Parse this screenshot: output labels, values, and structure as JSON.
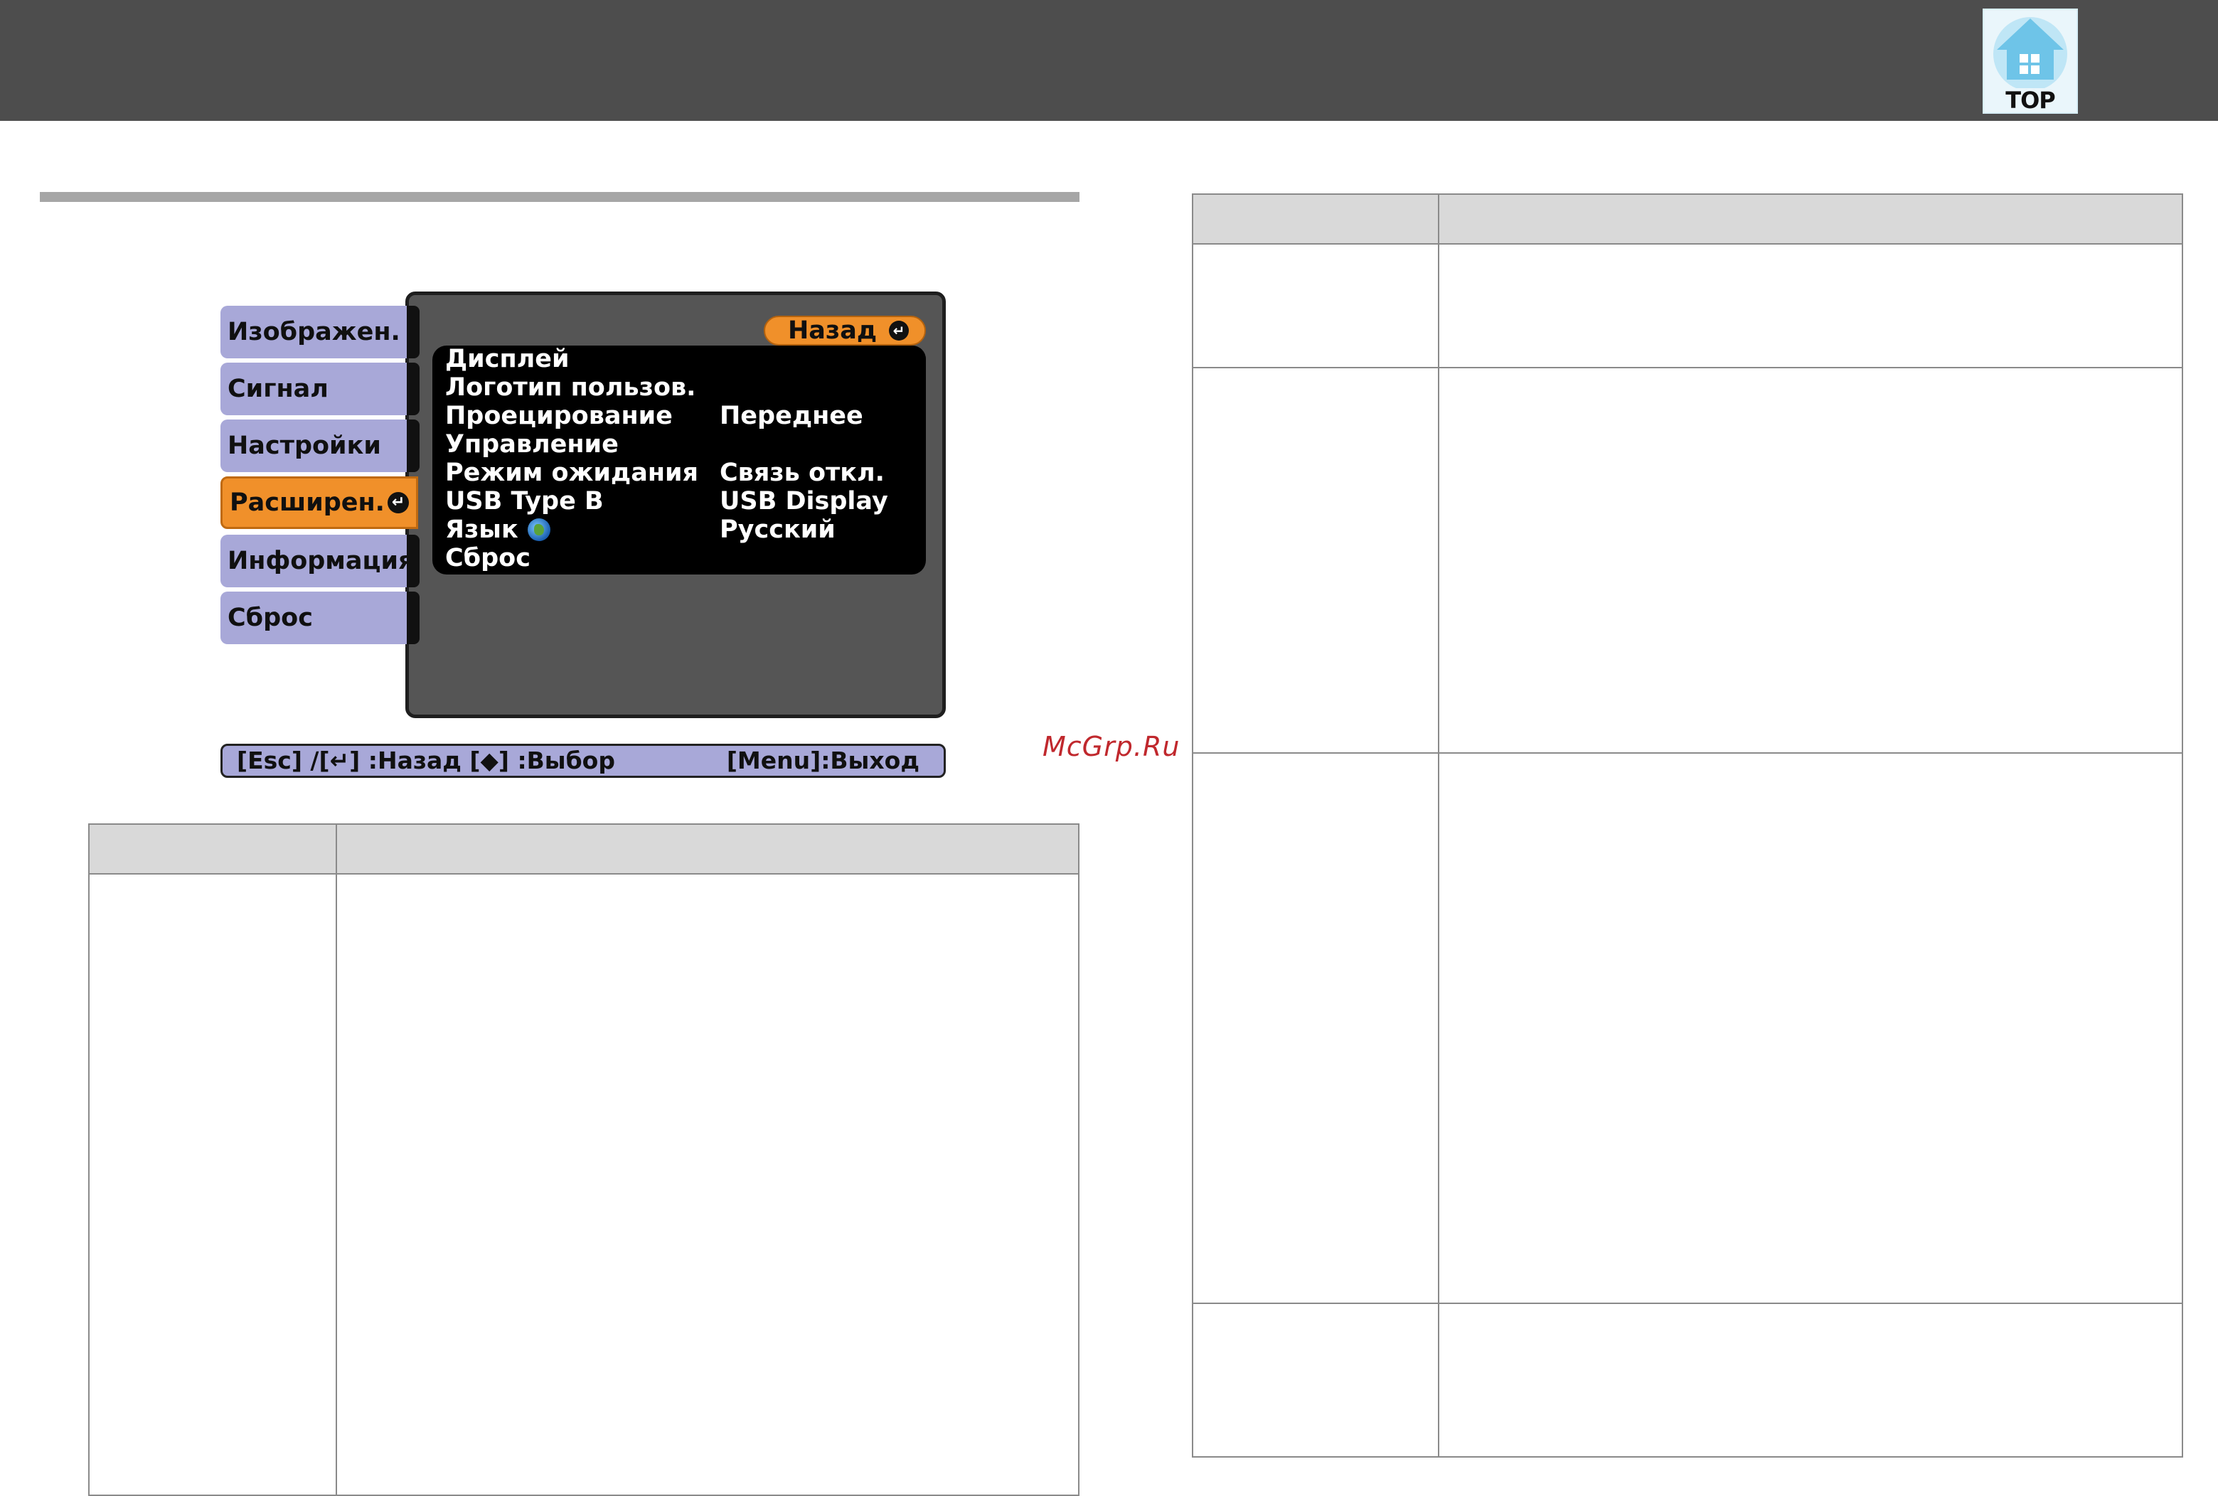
{
  "header": {
    "top_button_label": "TOP",
    "top_icon": "home-icon"
  },
  "menu_screen": {
    "tabs": [
      {
        "label": "Изображен.",
        "active": false
      },
      {
        "label": "Сигнал",
        "active": false
      },
      {
        "label": "Настройки",
        "active": false
      },
      {
        "label": "Расширен.",
        "active": true
      },
      {
        "label": "Информация",
        "active": false
      },
      {
        "label": "Сброс",
        "active": false
      }
    ],
    "back_button": "Назад",
    "enter_icon": "enter-icon",
    "items": [
      {
        "label": "Дисплей",
        "value": ""
      },
      {
        "label": "Логотип пользов.",
        "value": ""
      },
      {
        "label": "Проецирование",
        "value": "Переднее"
      },
      {
        "label": "Управление",
        "value": ""
      },
      {
        "label": "Режим ожидания",
        "value": "Связь откл."
      },
      {
        "label": "USB Type B",
        "value": "USB Display"
      },
      {
        "label": "Язык",
        "value": "Русский"
      },
      {
        "label": "Сброс",
        "value": ""
      }
    ],
    "language_icon": "globe-icon",
    "help_left": "[Esc] /[↵] :Назад  [◆] :Выбор",
    "help_right": "[Menu]:Выход"
  },
  "watermark": "McGrp.Ru",
  "colors": {
    "header_bg": "#4d4d4d",
    "tab_bg": "#a8a8d8",
    "active_orange": "#f0902a",
    "panel_bg": "#555555",
    "table_header_bg": "#d9d9d9",
    "watermark_red": "#c0282d"
  }
}
